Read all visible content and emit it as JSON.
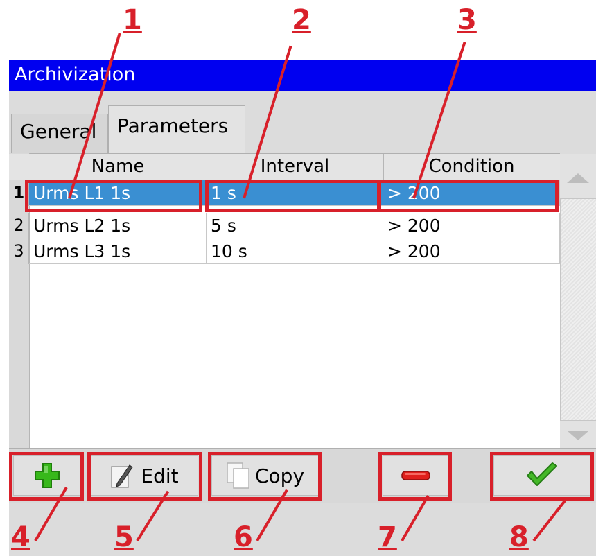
{
  "window": {
    "title": "Archivization"
  },
  "tabs": [
    {
      "label": "General",
      "active": false
    },
    {
      "label": "Parameters",
      "active": true
    }
  ],
  "table": {
    "columns": [
      "Name",
      "Interval",
      "Condition"
    ],
    "rows": [
      {
        "num": "1",
        "name": "Urms L1 1s",
        "interval": "1 s",
        "condition": "> 200",
        "selected": true
      },
      {
        "num": "2",
        "name": "Urms L2 1s",
        "interval": "5 s",
        "condition": "> 200",
        "selected": false
      },
      {
        "num": "3",
        "name": "Urms L3 1s",
        "interval": "10 s",
        "condition": "> 200",
        "selected": false
      }
    ]
  },
  "toolbar": {
    "add": {
      "icon": "plus-icon"
    },
    "edit": {
      "label": "Edit",
      "icon": "pencil-icon"
    },
    "copy": {
      "label": "Copy",
      "icon": "copy-icon"
    },
    "remove": {
      "icon": "minus-icon"
    },
    "ok": {
      "icon": "checkmark-icon"
    }
  },
  "callouts": [
    "1",
    "2",
    "3",
    "4",
    "5",
    "6",
    "7",
    "8"
  ],
  "colors": {
    "titlebar": "#0000f0",
    "selection": "#3a8fd2",
    "annotation": "#d8202a",
    "add_icon": "#37b81a",
    "remove_icon": "#e0201c",
    "ok_icon": "#44b828"
  }
}
